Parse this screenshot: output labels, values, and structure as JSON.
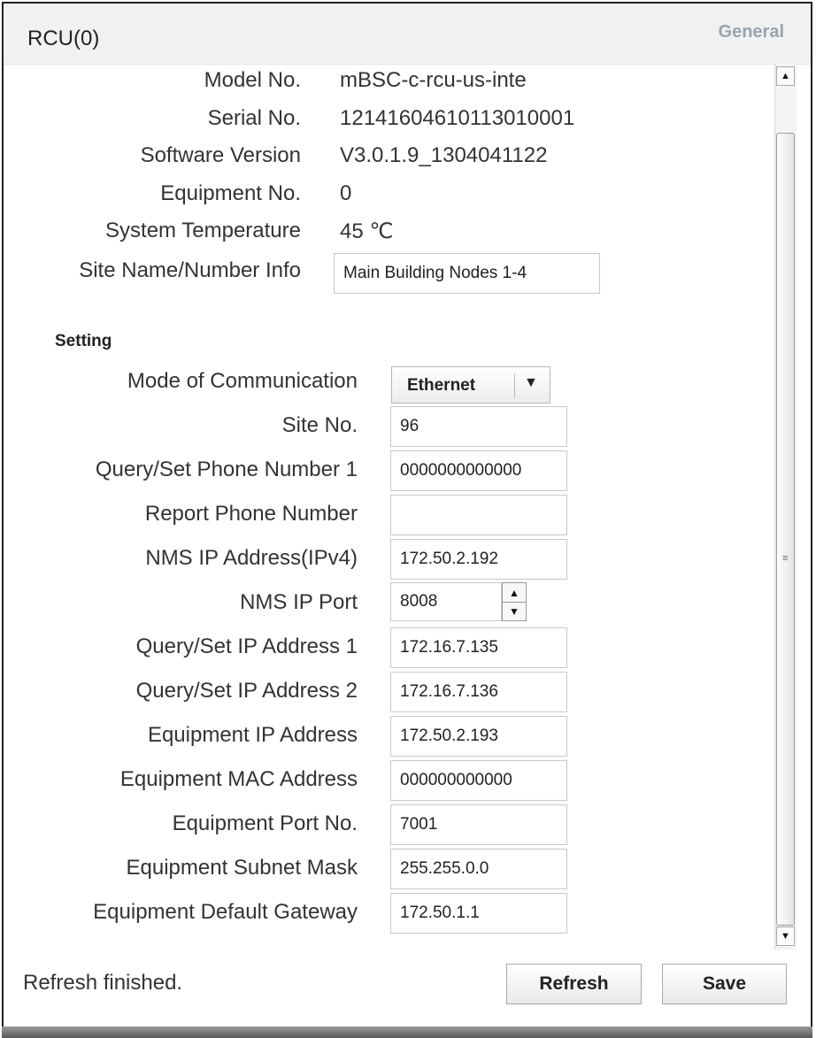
{
  "window": {
    "title": "RCU(0)",
    "tab": "General"
  },
  "info": {
    "model_no": {
      "label": "Model No.",
      "value": "mBSC-c-rcu-us-inte"
    },
    "serial_no": {
      "label": "Serial No.",
      "value": "12141604610113010001"
    },
    "software_version": {
      "label": "Software Version",
      "value": "V3.0.1.9_1304041122"
    },
    "equipment_no": {
      "label": "Equipment No.",
      "value": "0"
    },
    "system_temperature": {
      "label": "System Temperature",
      "value": "45   ℃"
    },
    "site_name": {
      "label": "Site Name/Number Info",
      "value": "Main Building Nodes 1-4"
    }
  },
  "setting": {
    "title": "Setting",
    "mode_of_communication": {
      "label": "Mode of Communication",
      "value": "Ethernet"
    },
    "site_no": {
      "label": "Site No.",
      "value": "96"
    },
    "query_phone_1": {
      "label": "Query/Set Phone Number 1",
      "value": "0000000000000"
    },
    "report_phone": {
      "label": "Report Phone Number",
      "value": ""
    },
    "nms_ip": {
      "label": "NMS IP Address(IPv4)",
      "value": "172.50.2.192"
    },
    "nms_port": {
      "label": "NMS IP Port",
      "value": "8008"
    },
    "query_ip_1": {
      "label": "Query/Set IP Address 1",
      "value": "172.16.7.135"
    },
    "query_ip_2": {
      "label": "Query/Set IP Address 2",
      "value": "172.16.7.136"
    },
    "equipment_ip": {
      "label": "Equipment IP Address",
      "value": "172.50.2.193"
    },
    "equipment_mac": {
      "label": "Equipment MAC Address",
      "value": "000000000000"
    },
    "equipment_port": {
      "label": "Equipment Port No.",
      "value": "7001"
    },
    "subnet_mask": {
      "label": "Equipment Subnet Mask",
      "value": "255.255.0.0"
    },
    "default_gateway": {
      "label": "Equipment Default Gateway",
      "value": "172.50.1.1"
    }
  },
  "footer": {
    "status": "Refresh finished.",
    "refresh_label": "Refresh",
    "save_label": "Save"
  }
}
